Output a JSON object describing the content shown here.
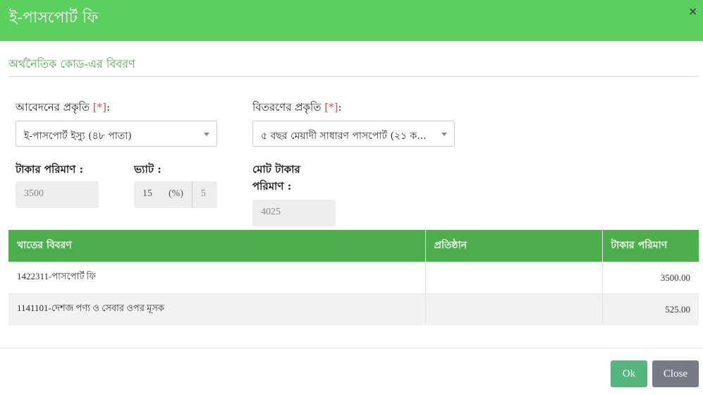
{
  "modal": {
    "title": "ই-পাসপোর্ট ফি",
    "close_symbol": "×"
  },
  "section": {
    "title": "অর্থনৈতিক কোড-এর বিবরণ"
  },
  "form": {
    "application_type": {
      "label": "আবেদনের প্রকৃতি",
      "required_marker": "[*]",
      "colon": ":",
      "selected": "ই-পাসপোর্ট ইস্যু (৪৮ পাতা)"
    },
    "delivery_type": {
      "label": "বিতরণের প্রকৃতি",
      "required_marker": "[*]",
      "colon": ":",
      "selected": "৫ বছর মেয়াদী সাধারণ পাসপোর্ট (২১ ক..."
    },
    "amount": {
      "label": "টাকার পরিমাণ :",
      "value": "3500"
    },
    "vat": {
      "label": "ভ্যাট :",
      "rate": "15",
      "percent_symbol": "(%)",
      "amount": "5"
    },
    "total": {
      "label_line1": "মোট টাকার",
      "label_line2": "পরিমাণ :",
      "value": "4025"
    }
  },
  "table": {
    "headers": [
      "খাতের বিবরণ",
      "প্রতিষ্ঠান",
      "টাকার পরিমাণ"
    ],
    "rows": [
      {
        "description": "1422311-পাসপোর্ট ফি",
        "institution": "",
        "amount": "3500.00"
      },
      {
        "description": "1141101-দেশজ পণ্য ও সেবার ওপর মূসক",
        "institution": "",
        "amount": "525.00"
      }
    ]
  },
  "buttons": {
    "ok": "Ok",
    "close": "Close"
  },
  "colors": {
    "header_bg": "#5cd05e",
    "table_header_bg": "#4cae4c",
    "ok_button": "#55b57e",
    "close_button": "#777b85",
    "required": "#d9534f"
  }
}
